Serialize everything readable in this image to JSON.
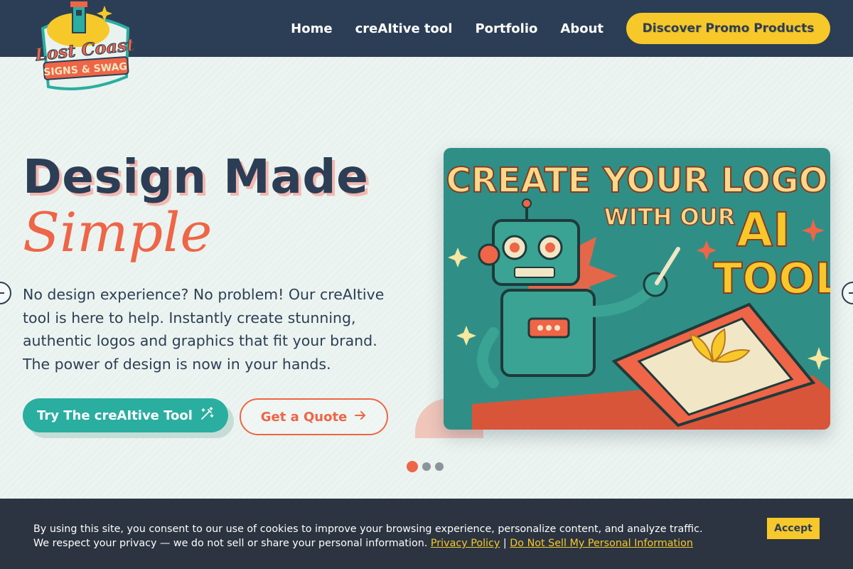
{
  "header": {
    "logo": {
      "line1": "Lost Coast",
      "line2": "SIGNS & SWAG"
    },
    "nav": [
      {
        "label": "Home"
      },
      {
        "label": "creAItive tool"
      },
      {
        "label": "Portfolio"
      },
      {
        "label": "About"
      }
    ],
    "cta_label": "Discover Promo Products"
  },
  "hero": {
    "title": "Design Made",
    "script": "Simple",
    "description": "No design experience? No problem! Our creAItive tool is here to help. Instantly create stunning, authentic logos and graphics that fit your brand. The power of design is now in your hands.",
    "primary_button": "Try The creAItive Tool",
    "secondary_button": "Get a Quote",
    "image": {
      "line1": "CREATE YOUR LOGO",
      "line2": "WITH OUR",
      "line3": "AI",
      "line4": "TOOL"
    }
  },
  "slider": {
    "slides": 3,
    "active": 1
  },
  "cookie": {
    "text": "By using this site, you consent to our use of cookies to improve your browsing experience, personalize content, and analyze traffic. We respect your privacy — we do not sell or share your personal information.",
    "privacy_link": "Privacy Policy",
    "separator": "|",
    "dnsmpi_link": "Do Not Sell My Personal Information",
    "accept_label": "Accept"
  },
  "colors": {
    "navy": "#2c3e55",
    "coral": "#ee6547",
    "teal": "#2aaea0",
    "yellow": "#f7c82a",
    "background": "#e9f2ee"
  }
}
